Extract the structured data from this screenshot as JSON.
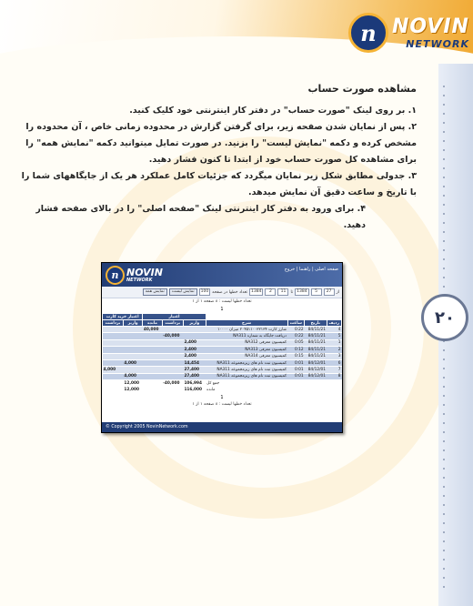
{
  "logo": {
    "brand": "NOVIN",
    "sub": "NETWORK",
    "glyph": "n"
  },
  "page_number": "۲۰",
  "heading": "مشاهده صورت حساب",
  "steps": [
    "۱.  بر روی لینک \"صورت حساب\" در دفتر کار اینترنتی خود کلیک کنید.",
    "۲.  پس از نمایان شدن صفحه زیر، برای گرفتن گزارش در محدوده زمانی خاص ، آن محدوده را مشخص کرده و دکمه \"نمایش لیست\" را بزنید. در صورت تمایل میتوانید دکمه \"نمایش همه\" را برای مشاهده کل صورت حساب خود از ابتدا تا کنون فشار دهید.",
    "۳.  جدولی مطابق شکل زیر نمایان میگردد که جزئیات کامل عملکرد هر یک از جایگاههای شما را با تاریخ و ساعت دقیق آن نمایش میدهد.",
    "۴.  برای ورود به دفتر کار اینترنتی لینک \"صفحه اصلی\" را در بالای صفحه فشار دهید."
  ],
  "screenshot": {
    "brand": "NOVIN",
    "sub": "NETWORK",
    "nav": "صفحه اصلی | راهنما | خروج",
    "toolbar": {
      "from_label": "از",
      "day1": "27",
      "month1": "5",
      "year1": "1384",
      "to_label": "تا",
      "day2": "11",
      "month2": "2",
      "year2": "1384",
      "rows_label": "تعداد خطها در صفحه",
      "rows": "100",
      "btn_list": "نمایش لیست",
      "btn_all": "نمایش همه"
    },
    "summary_line": "تعداد خطها لیست : ۸    صفحه ۱ از ۱",
    "page_indicator": "1",
    "group_headers": {
      "amount": "اعتبار",
      "credit": "اعتبار خرید کارت"
    },
    "columns": [
      "ردیف",
      "تاریخ",
      "ساعت",
      "شرح",
      "واریز",
      "برداشت",
      "مانده",
      "واریز",
      "برداشت"
    ],
    "rows": [
      {
        "n": "4",
        "date": "84/11/21",
        "time": "0:22",
        "desc": "شارژ کارت ۲۰۴۵۱۱۰۰۳۲۱۳۴ میزان ۱۰۰۰۰",
        "dep": "",
        "wd": "",
        "bal": "40,000",
        "dep2": "",
        "wd2": ""
      },
      {
        "n": "5",
        "date": "84/11/21",
        "time": "0:22",
        "desc": "دریافت جایگاه به شماره NA311",
        "dep": "",
        "wd": "-40,000",
        "bal": "",
        "dep2": "",
        "wd2": ""
      },
      {
        "n": "1",
        "date": "84/11/21",
        "time": "0:05",
        "desc": "کمیسیون معرفی NA312",
        "dep": "2,400",
        "wd": "",
        "bal": "",
        "dep2": "",
        "wd2": ""
      },
      {
        "n": "2",
        "date": "84/11/21",
        "time": "0:12",
        "desc": "کمیسیون معرفی NA313",
        "dep": "2,400",
        "wd": "",
        "bal": "",
        "dep2": "",
        "wd2": ""
      },
      {
        "n": "3",
        "date": "84/11/21",
        "time": "0:15",
        "desc": "کمیسیون معرفی NA314",
        "dep": "2,400",
        "wd": "",
        "bal": "",
        "dep2": "",
        "wd2": ""
      },
      {
        "n": "6",
        "date": "84/12/01",
        "time": "0:01",
        "desc": "کمیسیون ثبت نام های زیرمجموعه NA311",
        "dep": "14,454",
        "wd": "",
        "bal": "",
        "dep2": "4,000",
        "wd2": ""
      },
      {
        "n": "7",
        "date": "84/12/01",
        "time": "0:01",
        "desc": "کمیسیون ثبت نام های زیرمجموعه NA311",
        "dep": "27,400",
        "wd": "",
        "bal": "",
        "dep2": "",
        "wd2": "4,000"
      },
      {
        "n": "8",
        "date": "84/12/01",
        "time": "0:01",
        "desc": "کمیسیون ثبت نام های زیرمجموعه NA311",
        "dep": "27,400",
        "wd": "",
        "bal": "",
        "dep2": "4,000",
        "wd2": ""
      }
    ],
    "totals": [
      {
        "label": "جمع کل",
        "dep": "106,994",
        "wd": "-40,000",
        "bal": "",
        "dep2": "12,000",
        "wd2": ""
      },
      {
        "label": "مانده",
        "dep": "116,000",
        "wd": "",
        "bal": "",
        "dep2": "12,000",
        "wd2": ""
      }
    ],
    "bottom_page": "1",
    "bottom_summary": "تعداد خطها لیست : ۸    صفحه ۱ از ۱",
    "copyright": "© Copyright 2005 NovinNetwork.com"
  }
}
